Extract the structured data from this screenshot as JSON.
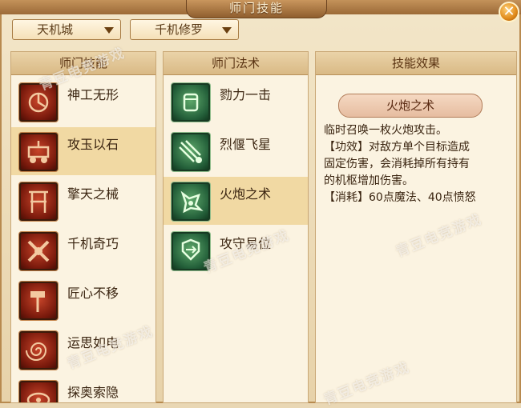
{
  "window": {
    "title": "师门技能"
  },
  "filters": {
    "sect": "天机城",
    "faction": "千机修罗"
  },
  "panels": {
    "skills": {
      "header": "师门技能"
    },
    "spells": {
      "header": "师门法术"
    },
    "effect": {
      "header": "技能效果"
    }
  },
  "skills": [
    {
      "label": "神工无形",
      "icon": "clockwork-icon",
      "selected": false
    },
    {
      "label": "攻玉以石",
      "icon": "siege-cart-icon",
      "selected": true
    },
    {
      "label": "擎天之械",
      "icon": "pillar-machine-icon",
      "selected": false
    },
    {
      "label": "千机奇巧",
      "icon": "gear-cross-icon",
      "selected": false
    },
    {
      "label": "匠心不移",
      "icon": "hammer-icon",
      "selected": false
    },
    {
      "label": "运思如电",
      "icon": "spiral-icon",
      "selected": false
    },
    {
      "label": "探奥索隐",
      "icon": "vortex-icon",
      "selected": false
    }
  ],
  "spells": [
    {
      "label": "勠力一击",
      "icon": "golem-fist-icon",
      "selected": false
    },
    {
      "label": "烈偃飞星",
      "icon": "shooting-star-icon",
      "selected": false
    },
    {
      "label": "火炮之术",
      "icon": "cannon-beast-icon",
      "selected": true
    },
    {
      "label": "攻守易位",
      "icon": "swap-shield-icon",
      "selected": false
    }
  ],
  "effect": {
    "name": "火炮之术",
    "lines": [
      "临时召唤一枚火炮攻击。",
      "【功效】对敌方单个目标造成",
      "固定伤害，会消耗掉所有持有",
      "的机枢增加伤害。",
      "【消耗】60点魔法、40点愤怒"
    ]
  },
  "watermark": {
    "text": "青豆电竞游戏"
  },
  "colors": {
    "title_bar": "#9c6a37",
    "selected_row": "#f1d9a3",
    "close_button": "#e08a1a"
  }
}
